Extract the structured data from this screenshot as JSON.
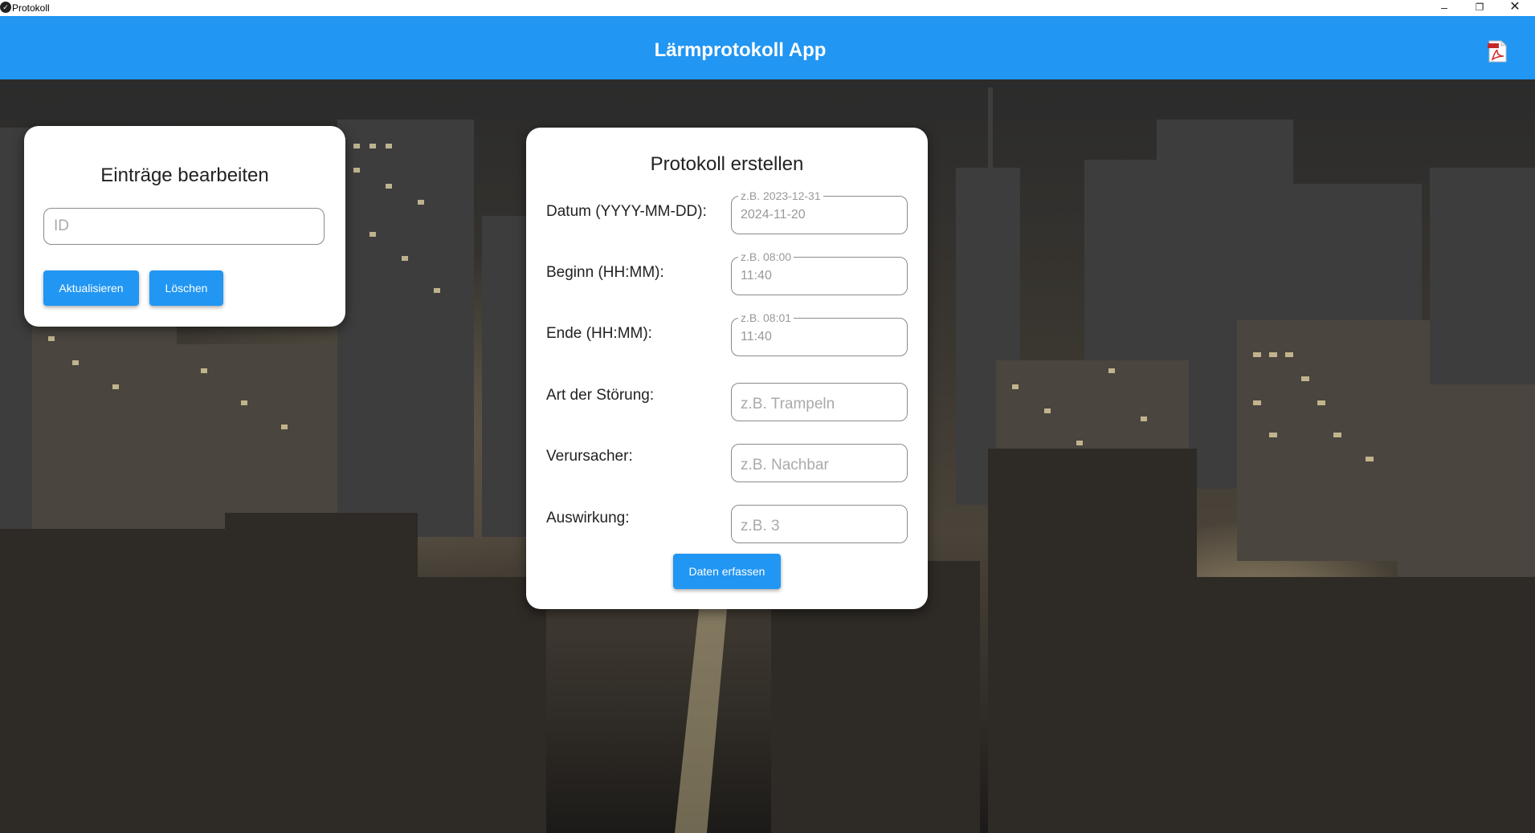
{
  "window": {
    "title": "Protokoll",
    "minimize_icon": "–",
    "maximize_icon": "❐",
    "close_icon": "✕"
  },
  "appbar": {
    "title": "Lärmprotokoll App",
    "color": "#2196f3",
    "pdf_icon": "pdf-icon"
  },
  "edit_card": {
    "title": "Einträge bearbeiten",
    "id_placeholder": "ID",
    "update_label": "Aktualisieren",
    "delete_label": "Löschen"
  },
  "create_card": {
    "title": "Protokoll erstellen",
    "fields": [
      {
        "label": "Datum (YYYY-MM-DD):",
        "hint": "z.B. 2023-12-31",
        "value": "2024-11-20"
      },
      {
        "label": "Beginn (HH:MM):",
        "hint": "z.B. 08:00",
        "value": "11:40"
      },
      {
        "label": "Ende (HH:MM):",
        "hint": "z.B. 08:01",
        "value": "11:40"
      },
      {
        "label": "Art der Störung:",
        "placeholder": "z.B. Trampeln"
      },
      {
        "label": "Verursacher:",
        "placeholder": "z.B. Nachbar"
      },
      {
        "label": "Auswirkung:",
        "placeholder": "z.B. 3"
      }
    ],
    "submit_label": "Daten erfassen"
  }
}
